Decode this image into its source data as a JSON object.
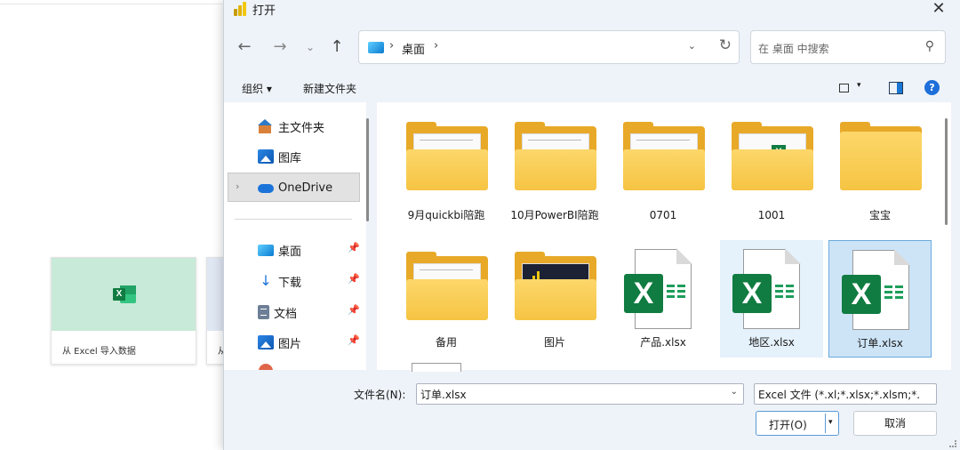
{
  "background": {
    "card1_label": "从 Excel 导入数据",
    "card2_label": "从"
  },
  "dialog": {
    "title": "打开",
    "close_glyph": "✕",
    "nav": {
      "back": "←",
      "forward": "→",
      "recent": "⌄",
      "up": "↑"
    },
    "address": {
      "separator": "›",
      "crumb": "桌面",
      "dropdown": "⌄",
      "refresh": "↻"
    },
    "search": {
      "placeholder": "在 桌面 中搜索",
      "icon": "⚲"
    },
    "toolbar": {
      "organize": "组织 ▾",
      "new_folder": "新建文件夹",
      "view_dropdown": "▾",
      "help": "?"
    },
    "sidebar": {
      "items": [
        {
          "label": "主文件夹",
          "icon": "home-icon"
        },
        {
          "label": "图库",
          "icon": "gallery-icon"
        },
        {
          "label": "OneDrive",
          "icon": "onedrive-icon",
          "selected": true
        },
        {
          "label": "桌面",
          "icon": "desktop-icon",
          "pinned": true
        },
        {
          "label": "下载",
          "icon": "download-icon",
          "pinned": true
        },
        {
          "label": "文档",
          "icon": "document-icon",
          "pinned": true
        },
        {
          "label": "图片",
          "icon": "pictures-icon",
          "pinned": true
        }
      ],
      "expander": "›",
      "pin_glyph": "📌"
    },
    "files": [
      {
        "label": "9月quickbi陪跑",
        "type": "folder"
      },
      {
        "label": "10月PowerBI陪跑",
        "type": "folder"
      },
      {
        "label": "0701",
        "type": "folder"
      },
      {
        "label": "1001",
        "type": "folder"
      },
      {
        "label": "宝宝",
        "type": "folder"
      },
      {
        "label": "备用",
        "type": "folder"
      },
      {
        "label": "图片",
        "type": "folder"
      },
      {
        "label": "产品.xlsx",
        "type": "excel"
      },
      {
        "label": "地区.xlsx",
        "type": "excel",
        "hover": true
      },
      {
        "label": "订单.xlsx",
        "type": "excel",
        "selected": true
      }
    ],
    "excel_badge": "X",
    "filename": {
      "label": "文件名(N):",
      "value": "订单.xlsx",
      "chevron": "⌄"
    },
    "filetype": {
      "value": "Excel 文件 (*.xl;*.xlsx;*.xlsm;*."
    },
    "buttons": {
      "open": "打开(O)",
      "open_split": "▾",
      "cancel": "取消"
    },
    "colors": {
      "accent": "#1e6fd9",
      "selection": "#cde4f7",
      "excel_green": "#107c41",
      "folder": "#f6c443"
    }
  }
}
